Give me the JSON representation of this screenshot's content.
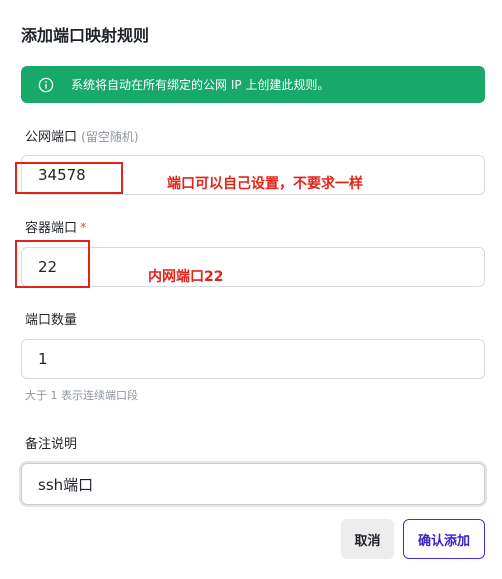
{
  "dialog": {
    "title": "添加端口映射规则",
    "alert": {
      "icon": "info-icon",
      "text": "系统将自动在所有绑定的公网 IP 上创建此规则。"
    },
    "public_port": {
      "label": "公网端口",
      "hint": "(留空随机)",
      "value": "34578"
    },
    "container_port": {
      "label": "容器端口",
      "required_mark": "*",
      "value": "22"
    },
    "port_count": {
      "label": "端口数量",
      "value": "1",
      "helper": "大于 1 表示连续端口段"
    },
    "remark": {
      "label": "备注说明",
      "value": "ssh端口"
    },
    "buttons": {
      "cancel": "取消",
      "confirm": "确认添加"
    }
  },
  "annotations": {
    "public_port_note": "端口可以自己设置，不要求一样",
    "container_port_note": "内网端口22"
  },
  "colors": {
    "alert_bg": "#17a86a",
    "annotation_red": "#e2231a",
    "confirm_border": "#4b2bd6"
  }
}
